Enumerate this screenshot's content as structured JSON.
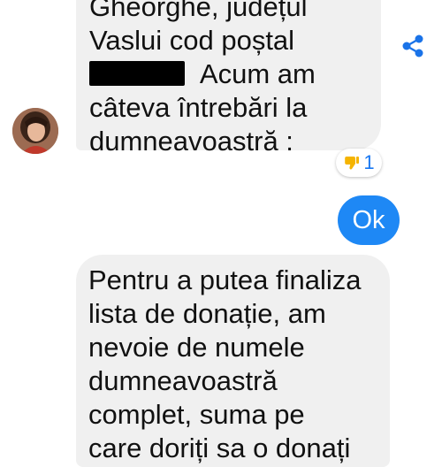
{
  "conversation": {
    "messages": [
      {
        "lines": [
          "Gheorghe, județul",
          "Vaslui cod poștal",
          " Acum am",
          "câteva întrebări la",
          "dumneavoastră :"
        ]
      },
      {
        "lines": [
          "Ok"
        ],
        "reaction": {
          "icon": "thumbs-down-icon",
          "count": "1"
        }
      },
      {
        "lines": [
          "Pentru a putea finaliza",
          "lista de donație, am",
          "nevoie de numele",
          "dumneavoastră",
          "complet, suma pe",
          "care doriți sa o donați"
        ]
      }
    ]
  },
  "icons": {
    "share": "share-icon",
    "avatar": "profile-avatar"
  },
  "colors": {
    "accent": "#1e88f5",
    "bubble_in": "#f0f0f0",
    "share": "#1a73e8",
    "reaction": "#f5b400"
  }
}
